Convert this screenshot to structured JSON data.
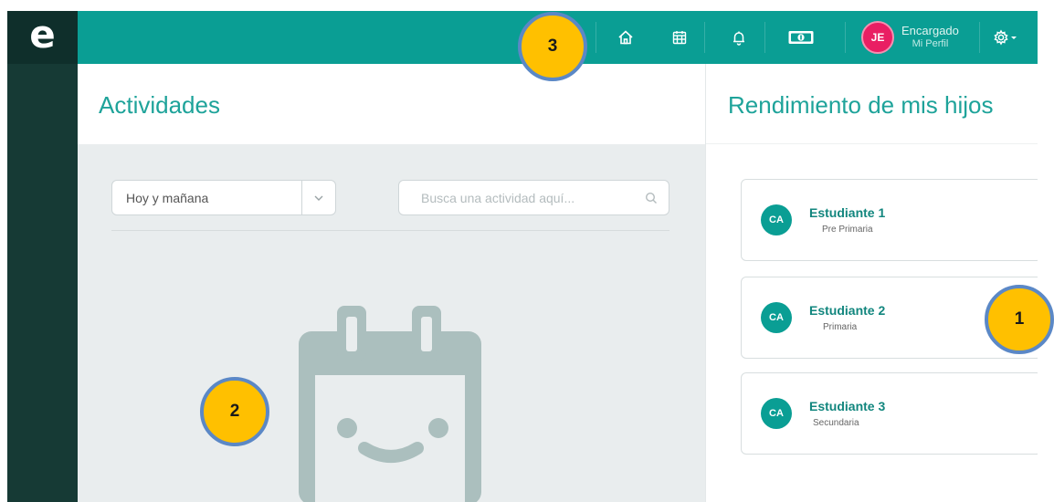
{
  "app": {
    "logo_letter": "e"
  },
  "topbar": {
    "icons": [
      "home-icon",
      "calendar-icon",
      "bell-icon",
      "money-icon",
      "gear-icon"
    ],
    "profile": {
      "initials": "JE",
      "role": "Encargado",
      "link": "Mi Perfil"
    }
  },
  "activities": {
    "title": "Actividades",
    "filter": {
      "selected": "Hoy y mañana"
    },
    "search": {
      "placeholder": "Busca una actividad aquí..."
    }
  },
  "performance": {
    "title": "Rendimiento de mis hijos",
    "students": [
      {
        "initials": "CA",
        "name": "Estudiante 1",
        "grade": "Pre Primaria"
      },
      {
        "initials": "CA",
        "name": "Estudiante 2",
        "grade": "Primaria"
      },
      {
        "initials": "CA",
        "name": "Estudiante 3",
        "grade": "Secundaria"
      }
    ]
  },
  "annotations": [
    "1",
    "2",
    "3"
  ],
  "colors": {
    "teal": "#0a9e94",
    "sidebar": "#163a35",
    "title_teal": "#1ea39a",
    "avatar_pink": "#e91e63",
    "badge_yellow": "#ffc000",
    "badge_border": "#5b88c6"
  }
}
